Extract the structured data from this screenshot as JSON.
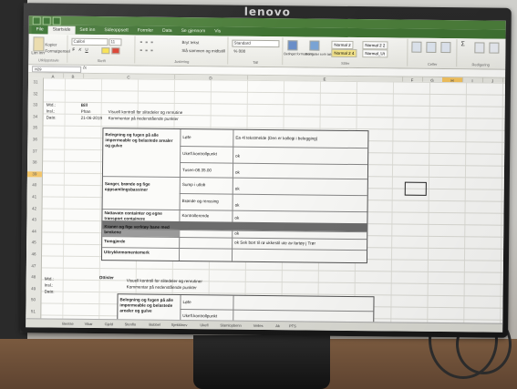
{
  "monitor": {
    "brand": "lenovo"
  },
  "excel": {
    "ribbon_tabs": [
      "File",
      "Startside",
      "Sett inn",
      "Sideoppsett",
      "Formler",
      "Data",
      "Se gjennom",
      "Vis"
    ],
    "ribbon": {
      "paste_label": "Lim inn",
      "copy_label": "Kopier",
      "format_painter_label": "Formatpensel",
      "font_name": "Calibri",
      "font_size": "11",
      "wrap_label": "Bryt tekst",
      "merge_label": "Slå sammen og midtstill",
      "number_format": "Standard",
      "cond_format_label": "Betinget formatering",
      "format_table_label": "Formater som tabell",
      "styles": [
        "Normal 2",
        "Normal 2 2",
        "Normal 2 4",
        "Normal_Ut"
      ],
      "groups": {
        "clipboard": "Utklippstavle",
        "font": "Skrift",
        "alignment": "Justering",
        "number": "Tall",
        "styles": "Stiler",
        "cells": "Celler",
        "editing": "Redigering"
      }
    },
    "name_box": "H29",
    "fx": "fx",
    "columns": [
      "A",
      "B",
      "C",
      "D",
      "E",
      "F",
      "G",
      "H",
      "I",
      "J"
    ],
    "rows": [
      "31",
      "32",
      "33",
      "34",
      "35",
      "36",
      "37",
      "38",
      "39",
      "40",
      "41",
      "42",
      "43",
      "44",
      "45",
      "46",
      "47",
      "48",
      "49",
      "50",
      "51"
    ],
    "header_info": {
      "mmsi_label": "Mtd.:",
      "mmsi_value": "Bill",
      "insp_label": "Insl.:",
      "insp_value": "Phan",
      "date_label": "Dato:",
      "date_value": "21-06-2019",
      "desc1": "Visuell kontroll for slitedeler og renrutine",
      "desc2": "Kommentar på nedenstående punkter"
    },
    "table1": {
      "rows": [
        {
          "label": "Belegning og fugen på alle impermeable og belastede arealer og gulve",
          "sub": [
            "Løfe",
            "Ukefl.kontrollpunkt",
            "Tusen-08.35.00"
          ],
          "note": [
            "Ea 4l tekstmelde (Den er kollegi i belegging)",
            "ok",
            "ok"
          ]
        },
        {
          "label": "Sanger, brønde og fige oppsamlingsbassiner",
          "sub": [
            "Sump i utlob",
            "Brønde og renssing"
          ],
          "note": [
            "ok",
            "ok"
          ]
        },
        {
          "label": "Nattavatn containter og egne transport containere",
          "sub": [
            "Kontrollerende"
          ],
          "note": [
            "ok"
          ]
        },
        {
          "label": "Kraner og fige verktøy bane med benkene",
          "sub": [
            ""
          ],
          "note": [
            "ok"
          ]
        },
        {
          "label": "Tomgjerde",
          "sub": [
            ""
          ],
          "note": [
            "ok  Sek bort til rø ukkestil ute av fartøy j Trør"
          ]
        },
        {
          "label": "Uttrykkemomentemerk",
          "sub": [
            ""
          ],
          "note": [
            ""
          ]
        }
      ]
    },
    "lower": {
      "mmsi_label": "Mtd.:",
      "mmsi_value": "Ottisler",
      "insp_label": "Insl.:",
      "date_label": "Dato:",
      "desc1": "Visuell kontroll for slitedeler og renrutiner",
      "desc2": "Kommentar på nedenstående punkter",
      "t_row1": "Belegning og fugen på alle impermeable og belastede arealer og gulve",
      "t_sub1": "Løfe",
      "t_sub2": "Ukefl.kontrollpunkt"
    },
    "sheet_tabs": [
      "Bentse",
      "Vikar",
      "Gjeld",
      "Stenflo",
      "Bobbel",
      "Sjekkbrev",
      "Ukefl",
      "Slamlopbenn",
      "Veiles",
      "Ak",
      "PTS"
    ]
  }
}
